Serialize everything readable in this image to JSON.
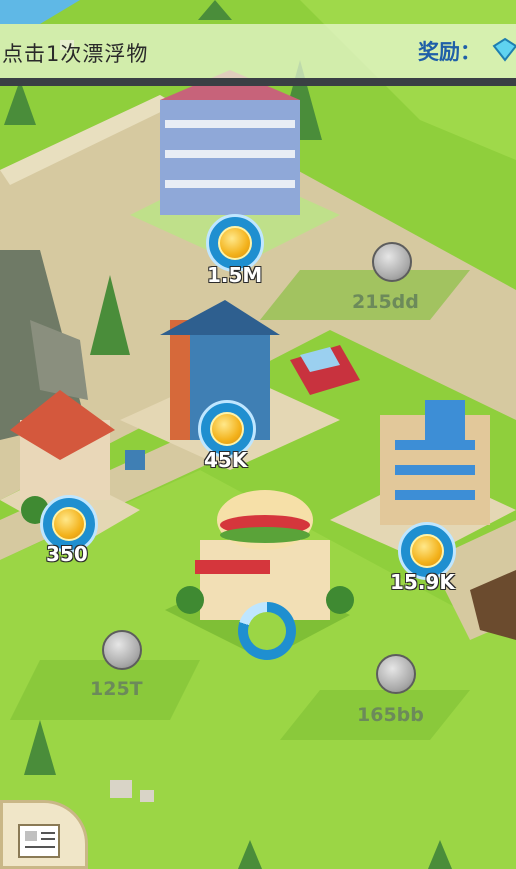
{
  "banner": {
    "mission_text": "点击1次漂浮物",
    "reward_label": "奖励："
  },
  "buildings": [
    {
      "name": "mansion",
      "income": "1.5M"
    },
    {
      "name": "blue-house",
      "income": "45K"
    },
    {
      "name": "cottage",
      "income": "350"
    },
    {
      "name": "office",
      "income": "15.9K"
    }
  ],
  "locked_plots": [
    {
      "price": "215dd"
    },
    {
      "price": "125T"
    },
    {
      "price": "165bb"
    }
  ],
  "colors": {
    "grass": "#8fcf3c",
    "road": "#d6c9a0",
    "coin_ring": "#1f8fd0",
    "coin_gold": "#f3b21b"
  }
}
